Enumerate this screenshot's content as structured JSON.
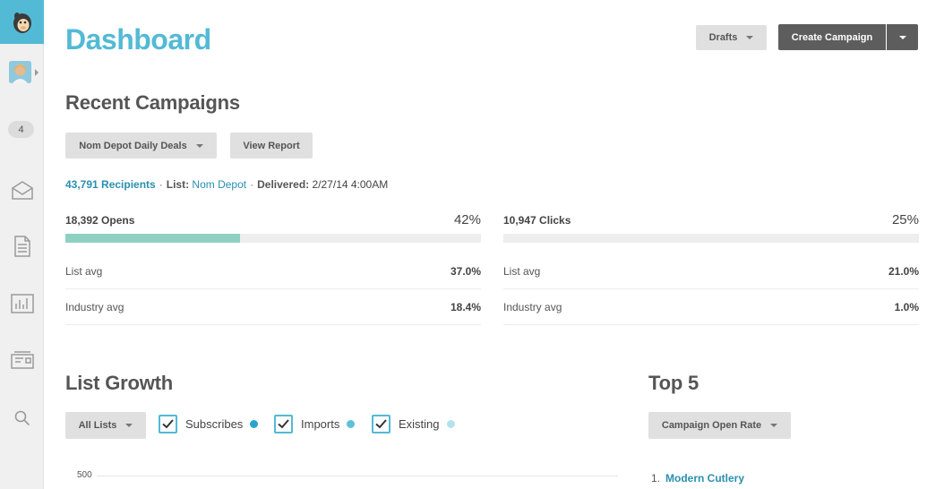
{
  "sidebar": {
    "logo_icon": "mailchimp-logo",
    "count_badge": "4",
    "items": [
      {
        "icon": "campaigns-envelope-icon"
      },
      {
        "icon": "templates-document-icon"
      },
      {
        "icon": "reports-chart-icon"
      },
      {
        "icon": "autoresponders-icon"
      },
      {
        "icon": "search-icon"
      }
    ]
  },
  "header": {
    "title": "Dashboard",
    "drafts_label": "Drafts",
    "create_label": "Create Campaign"
  },
  "recent": {
    "title": "Recent Campaigns",
    "campaign_select": "Nom Depot Daily Deals",
    "view_report_label": "View Report",
    "recipients": "43,791 Recipients",
    "list_label": "List:",
    "list_value": "Nom Depot",
    "delivered_label": "Delivered:",
    "delivered_value": "2/27/14 4:00AM",
    "opens": {
      "label": "18,392 Opens",
      "pct": "42%",
      "fill": 0.42,
      "rows": [
        {
          "label": "List avg",
          "value": "37.0%"
        },
        {
          "label": "Industry avg",
          "value": "18.4%"
        }
      ]
    },
    "clicks": {
      "label": "10,947 Clicks",
      "pct": "25%",
      "fill": 0.0,
      "rows": [
        {
          "label": "List avg",
          "value": "21.0%"
        },
        {
          "label": "Industry avg",
          "value": "1.0%"
        }
      ]
    }
  },
  "growth": {
    "title": "List Growth",
    "list_select": "All Lists",
    "toggles": [
      {
        "label": "Subscribes",
        "checked": true,
        "color": "#29a3cc"
      },
      {
        "label": "Imports",
        "checked": true,
        "color": "#5ec1d9"
      },
      {
        "label": "Existing",
        "checked": true,
        "color": "#b3e2ee"
      }
    ],
    "y_tick": "500"
  },
  "top5": {
    "title": "Top 5",
    "metric_select": "Campaign Open Rate",
    "items": [
      {
        "rank": "1.",
        "name": "Modern Cutlery"
      }
    ]
  }
}
